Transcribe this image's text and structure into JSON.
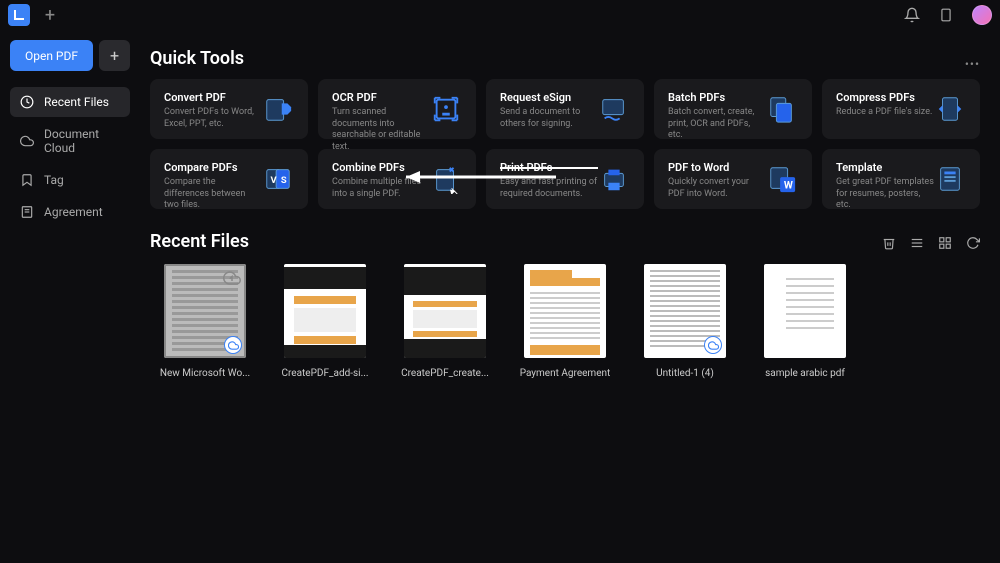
{
  "titlebar": {
    "new_tab_glyph": "+"
  },
  "sidebar": {
    "open_pdf_label": "Open PDF",
    "plus_glyph": "+",
    "nav": [
      {
        "label": "Recent Files",
        "active": true,
        "icon": "clock"
      },
      {
        "label": "Document Cloud",
        "active": false,
        "icon": "cloud"
      },
      {
        "label": "Tag",
        "active": false,
        "icon": "bookmark"
      },
      {
        "label": "Agreement",
        "active": false,
        "icon": "agreement"
      }
    ]
  },
  "quick_tools": {
    "title": "Quick Tools",
    "items": [
      {
        "title": "Convert PDF",
        "desc": "Convert PDFs to Word, Excel, PPT, etc."
      },
      {
        "title": "OCR PDF",
        "desc": "Turn scanned documents into searchable or editable text."
      },
      {
        "title": "Request eSign",
        "desc": "Send a document to others for signing."
      },
      {
        "title": "Batch PDFs",
        "desc": "Batch convert, create, print, OCR and PDFs, etc."
      },
      {
        "title": "Compress PDFs",
        "desc": "Reduce a PDF file's size."
      },
      {
        "title": "Compare PDFs",
        "desc": "Compare the differences between two files."
      },
      {
        "title": "Combine PDFs",
        "desc": "Combine multiple files into a single PDF."
      },
      {
        "title": "Print PDFs",
        "desc": "Easy and fast printing of required documents."
      },
      {
        "title": "PDF to Word",
        "desc": "Quickly convert your PDF into Word."
      },
      {
        "title": "Template",
        "desc": "Get great PDF templates for resumes, posters, etc."
      }
    ]
  },
  "recent_files": {
    "title": "Recent Files",
    "items": [
      {
        "name": "New Microsoft Wo...",
        "selected": true,
        "cloud_up": true,
        "cloud_sync": true,
        "style": "graylines"
      },
      {
        "name": "CreatePDF_add-si...",
        "selected": false,
        "style": "orange_doc_wide"
      },
      {
        "name": "CreatePDF_create...",
        "selected": false,
        "style": "orange_doc_wide_dark"
      },
      {
        "name": "Payment Agreement",
        "selected": false,
        "style": "orange_header_footer"
      },
      {
        "name": "Untitled-1 (4)",
        "selected": false,
        "cloud_sync": true,
        "style": "text_dense"
      },
      {
        "name": "sample arabic pdf",
        "selected": false,
        "style": "text_sparse"
      }
    ]
  }
}
